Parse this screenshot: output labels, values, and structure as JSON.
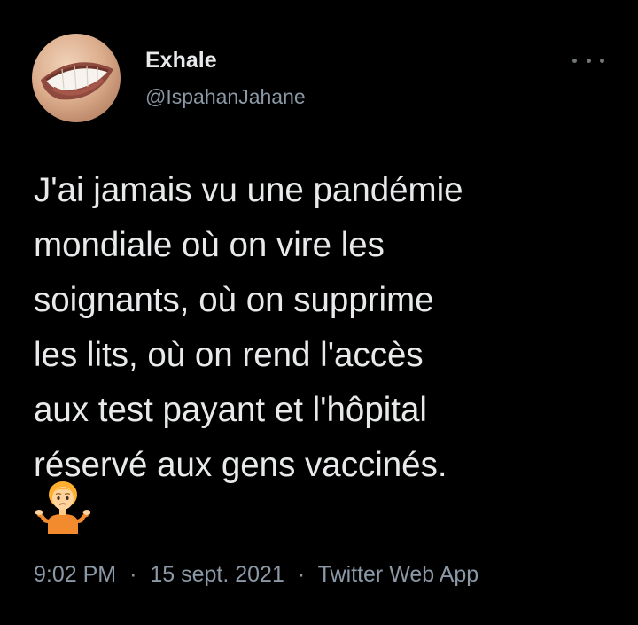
{
  "author": {
    "display_name": "Exhale",
    "handle": "@IspahanJahane"
  },
  "more_menu_icon": "more-dots-icon",
  "tweet": {
    "lines": [
      "J'ai jamais vu une pandémie",
      "mondiale où on vire les",
      "soignants, où on supprime",
      "les lits, où on rend l'accès",
      "aux test payant et l'hôpital",
      "réservé aux gens vaccinés."
    ],
    "emoji": "person-shrugging-emoji"
  },
  "meta": {
    "time": "9:02 PM",
    "separator": "·",
    "date": "15 sept. 2021",
    "source": "Twitter Web App"
  },
  "colors": {
    "background": "#000000",
    "text": "#e7e9ea",
    "secondary_text": "#8b98a5"
  }
}
